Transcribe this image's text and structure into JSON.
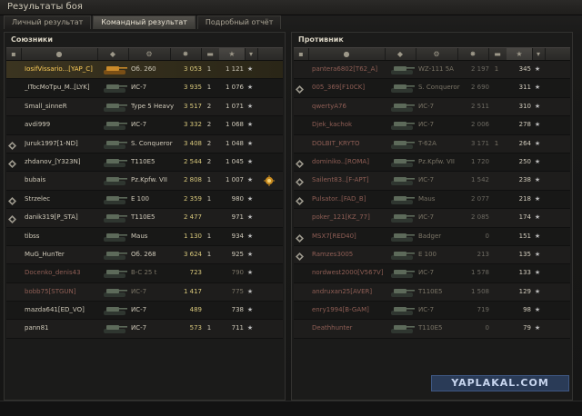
{
  "window": {
    "title": "Результаты боя"
  },
  "tabs": [
    {
      "label": "Личный результат",
      "active": false
    },
    {
      "label": "Командный результат",
      "active": true
    },
    {
      "label": "Подробный отчёт",
      "active": false
    }
  ],
  "allies": {
    "title": "Союзники",
    "rows": [
      {
        "name": "IosifVissario...[YAP_C]",
        "tank": "Об. 260",
        "damage": "3 053",
        "frags": "1",
        "xp": "1 121",
        "platoon": false,
        "self": true,
        "dead": false,
        "medal": false
      },
      {
        "name": "_ITocMoTpu_M..[LYK]",
        "tank": "ИС-7",
        "damage": "3 935",
        "frags": "1",
        "xp": "1 076",
        "platoon": false,
        "self": false,
        "dead": false,
        "medal": false
      },
      {
        "name": "Small_sinneR",
        "tank": "Type 5 Heavy",
        "damage": "3 517",
        "frags": "2",
        "xp": "1 071",
        "platoon": false,
        "self": false,
        "dead": false,
        "medal": false
      },
      {
        "name": "avdi999",
        "tank": "ИС-7",
        "damage": "3 332",
        "frags": "2",
        "xp": "1 068",
        "platoon": false,
        "self": false,
        "dead": false,
        "medal": false
      },
      {
        "name": "Juruk1997[1-ND]",
        "tank": "S. Conqueror",
        "damage": "3 408",
        "frags": "2",
        "xp": "1 048",
        "platoon": true,
        "self": false,
        "dead": false,
        "medal": false
      },
      {
        "name": "zhdanov_[Y323N]",
        "tank": "T110E5",
        "damage": "2 544",
        "frags": "2",
        "xp": "1 045",
        "platoon": true,
        "self": false,
        "dead": false,
        "medal": false
      },
      {
        "name": "bubais",
        "tank": "Pz.Kpfw. VII",
        "damage": "2 808",
        "frags": "1",
        "xp": "1 007",
        "platoon": false,
        "self": false,
        "dead": false,
        "medal": true
      },
      {
        "name": "Strzelec",
        "tank": "E 100",
        "damage": "2 359",
        "frags": "1",
        "xp": "980",
        "platoon": true,
        "self": false,
        "dead": false,
        "medal": false
      },
      {
        "name": "danik319[P_STA]",
        "tank": "T110E5",
        "damage": "2 477",
        "frags": "",
        "xp": "971",
        "platoon": true,
        "self": false,
        "dead": false,
        "medal": false
      },
      {
        "name": "tibss",
        "tank": "Maus",
        "damage": "1 130",
        "frags": "1",
        "xp": "934",
        "platoon": false,
        "self": false,
        "dead": false,
        "medal": false
      },
      {
        "name": "MuG_HunTer",
        "tank": "Об. 268",
        "damage": "3 624",
        "frags": "1",
        "xp": "925",
        "platoon": false,
        "self": false,
        "dead": false,
        "medal": false
      },
      {
        "name": "Docenko_denis43",
        "tank": "В-С 25 t",
        "damage": "723",
        "frags": "",
        "xp": "790",
        "platoon": false,
        "self": false,
        "dead": true,
        "medal": false
      },
      {
        "name": "bobb75[STGUN]",
        "tank": "ИС-7",
        "damage": "1 417",
        "frags": "",
        "xp": "775",
        "platoon": false,
        "self": false,
        "dead": true,
        "medal": false
      },
      {
        "name": "mazda641[ED_VO]",
        "tank": "ИС-7",
        "damage": "489",
        "frags": "",
        "xp": "738",
        "platoon": false,
        "self": false,
        "dead": false,
        "medal": false
      },
      {
        "name": "pann81",
        "tank": "ИС-7",
        "damage": "573",
        "frags": "1",
        "xp": "711",
        "platoon": false,
        "self": false,
        "dead": false,
        "medal": false
      }
    ]
  },
  "enemies": {
    "title": "Противник",
    "rows": [
      {
        "name": "pantera6802[T62_A]",
        "tank": "WZ-111 5A",
        "damage": "2 197",
        "frags": "1",
        "xp": "345",
        "platoon": false,
        "dead": true
      },
      {
        "name": "005_369[F10CK]",
        "tank": "S. Conqueror",
        "damage": "2 690",
        "frags": "",
        "xp": "311",
        "platoon": true,
        "dead": true
      },
      {
        "name": "qwertyA76",
        "tank": "ИС-7",
        "damage": "2 511",
        "frags": "",
        "xp": "310",
        "platoon": false,
        "dead": true
      },
      {
        "name": "Djek_kachok",
        "tank": "ИС-7",
        "damage": "2 006",
        "frags": "",
        "xp": "278",
        "platoon": false,
        "dead": true
      },
      {
        "name": "DOLBIT_KRYTO",
        "tank": "T-62A",
        "damage": "3 171",
        "frags": "1",
        "xp": "264",
        "platoon": false,
        "dead": true
      },
      {
        "name": "dominiko..[ROMA]",
        "tank": "Pz.Kpfw. VII",
        "damage": "1 720",
        "frags": "",
        "xp": "250",
        "platoon": true,
        "dead": true
      },
      {
        "name": "Sailent83..[F-APT]",
        "tank": "ИС-7",
        "damage": "1 542",
        "frags": "",
        "xp": "238",
        "platoon": true,
        "dead": true
      },
      {
        "name": "Pulsator..[FAD_B]",
        "tank": "Maus",
        "damage": "2 077",
        "frags": "",
        "xp": "218",
        "platoon": true,
        "dead": true
      },
      {
        "name": "poker_121[KZ_77]",
        "tank": "ИС-7",
        "damage": "2 085",
        "frags": "",
        "xp": "174",
        "platoon": false,
        "dead": true
      },
      {
        "name": "MSX7[RED40]",
        "tank": "Badger",
        "damage": "0",
        "frags": "",
        "xp": "151",
        "platoon": true,
        "dead": true
      },
      {
        "name": "Ramzes3005",
        "tank": "E 100",
        "damage": "213",
        "frags": "",
        "xp": "135",
        "platoon": true,
        "dead": true
      },
      {
        "name": "nordwest2000[V567V]",
        "tank": "ИС-7",
        "damage": "1 578",
        "frags": "",
        "xp": "133",
        "platoon": false,
        "dead": true
      },
      {
        "name": "andruxan25[AVER]",
        "tank": "T110E5",
        "damage": "1 508",
        "frags": "",
        "xp": "129",
        "platoon": false,
        "dead": true
      },
      {
        "name": "enry1994[B-GAM]",
        "tank": "ИС-7",
        "damage": "719",
        "frags": "",
        "xp": "98",
        "platoon": false,
        "dead": true
      },
      {
        "name": "Deathhunter",
        "tank": "T110E5",
        "damage": "0",
        "frags": "",
        "xp": "79",
        "platoon": false,
        "dead": true
      }
    ]
  },
  "watermark": "YAPLAKAL.COM",
  "colors": {
    "self_highlight": "#ffcf5a",
    "dead_name": "#8f5e55",
    "damage": "#d7c77b"
  }
}
